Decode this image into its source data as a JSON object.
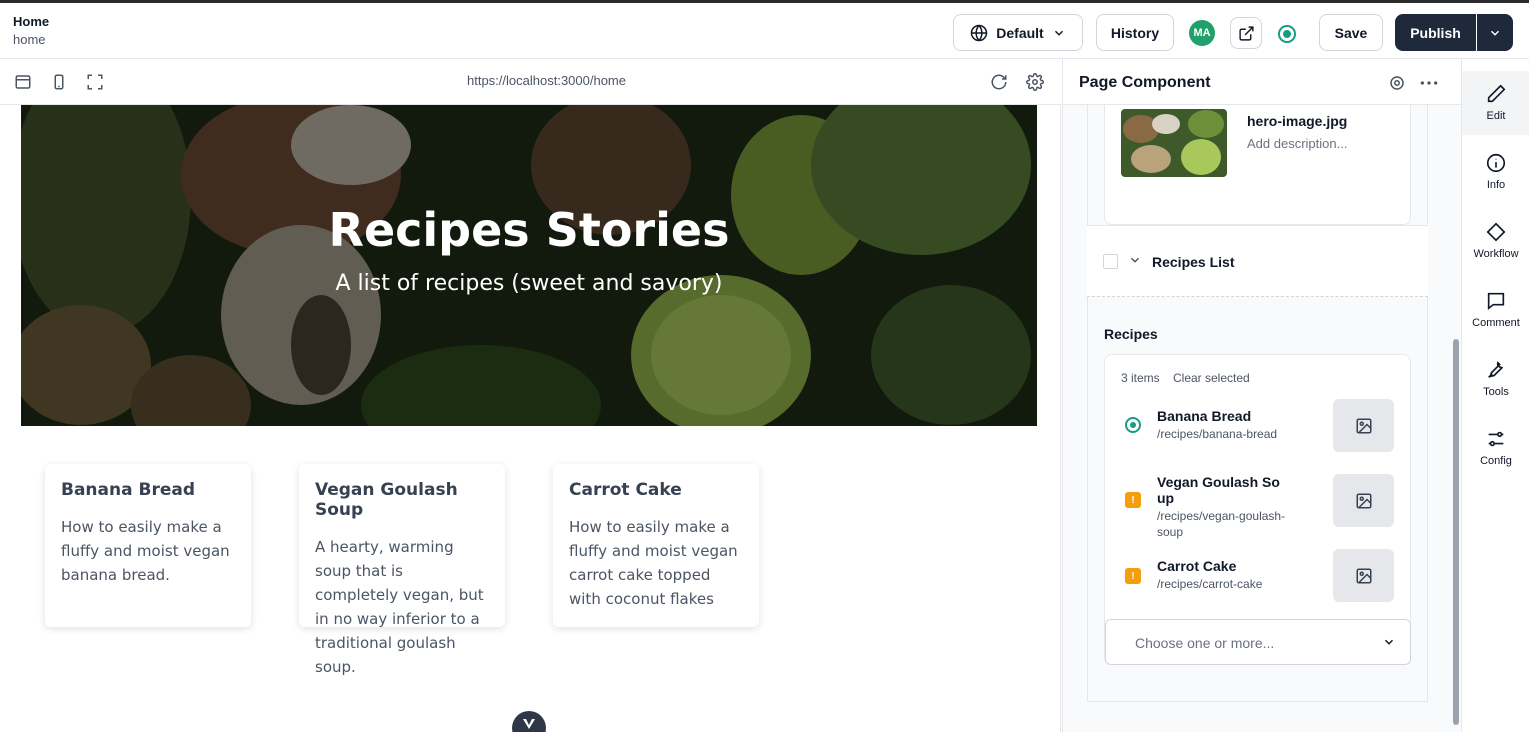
{
  "header": {
    "title": "Home",
    "subtitle": "home",
    "locale_label": "Default",
    "history_label": "History",
    "avatar_initials": "MA",
    "save_label": "Save",
    "publish_label": "Publish"
  },
  "preview": {
    "url": "https://localhost:3000/home",
    "hero": {
      "title": "Recipes Stories",
      "subtitle": "A list of recipes (sweet and savory)"
    },
    "cards": [
      {
        "title": "Banana Bread",
        "description": "How to easily make a fluffy and moist vegan banana bread."
      },
      {
        "title": "Vegan Goulash Soup",
        "description": "A hearty, warming soup that is completely vegan, but in no way inferior to a traditional goulash soup."
      },
      {
        "title": "Carrot Cake",
        "description": "How to easily make a fluffy and moist vegan carrot cake topped with coconut flakes"
      }
    ]
  },
  "panel": {
    "title": "Page Component",
    "media": {
      "filename": "hero-image.jpg",
      "description_placeholder": "Add description..."
    },
    "list_label": "Recipes List",
    "recipes_label": "Recipes",
    "count_label": "3 items",
    "clear_label": "Clear selected",
    "items": [
      {
        "title": "Banana Bread",
        "path": "/recipes/banana-bread",
        "status": "published"
      },
      {
        "title": "Vegan Goulash So up",
        "path": "/recipes/vegan-goulash-soup",
        "status": "warning"
      },
      {
        "title": "Carrot Cake",
        "path": "/recipes/carrot-cake",
        "status": "warning"
      }
    ],
    "select_placeholder": "Choose one or more..."
  },
  "rail": [
    {
      "label": "Edit",
      "icon": "pencil-icon"
    },
    {
      "label": "Info",
      "icon": "info-icon"
    },
    {
      "label": "Workflow",
      "icon": "diamond-icon"
    },
    {
      "label": "Comment",
      "icon": "comment-icon"
    },
    {
      "label": "Tools",
      "icon": "tools-icon"
    },
    {
      "label": "Config",
      "icon": "sliders-icon"
    }
  ],
  "colors": {
    "accent": "#179c84",
    "warning": "#f59e0b",
    "publish": "#1e293b",
    "avatar": "#22a06b"
  }
}
